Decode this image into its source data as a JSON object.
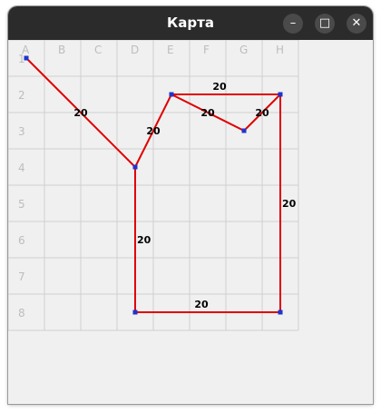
{
  "window": {
    "title": "Карта"
  },
  "controls": {
    "minimize_icon": "minimize-icon",
    "maximize_icon": "maximize-icon",
    "close_icon": "close-icon"
  },
  "map": {
    "columns": [
      "A",
      "B",
      "C",
      "D",
      "E",
      "F",
      "G",
      "H"
    ],
    "rows": [
      "1",
      "2",
      "3",
      "4",
      "5",
      "6",
      "7",
      "8"
    ],
    "points": [
      {
        "id": "p1",
        "col": "A",
        "row": "1"
      },
      {
        "id": "p2",
        "col": "D",
        "row": "4"
      },
      {
        "id": "p3",
        "col": "E",
        "row": "2"
      },
      {
        "id": "p4",
        "col": "H",
        "row": "2"
      },
      {
        "id": "p5",
        "col": "G",
        "row": "3"
      },
      {
        "id": "p6",
        "col": "D",
        "row": "8"
      },
      {
        "id": "p7",
        "col": "H",
        "row": "8"
      }
    ],
    "edges": [
      {
        "from": "p1",
        "to": "p2",
        "label": "20"
      },
      {
        "from": "p2",
        "to": "p3",
        "label": "20"
      },
      {
        "from": "p3",
        "to": "p5",
        "label": "20"
      },
      {
        "from": "p3",
        "to": "p4",
        "label": "20"
      },
      {
        "from": "p5",
        "to": "p4",
        "label": "20"
      },
      {
        "from": "p2",
        "to": "p6",
        "label": "20"
      },
      {
        "from": "p6",
        "to": "p7",
        "label": "20"
      },
      {
        "from": "p4",
        "to": "p7",
        "label": "20"
      }
    ],
    "colors": {
      "grid": "#d0d0d0",
      "grid_label": "#bdbdbd",
      "edge": "#e00000",
      "point": "#2233cc",
      "weight_text": "#000000"
    }
  }
}
